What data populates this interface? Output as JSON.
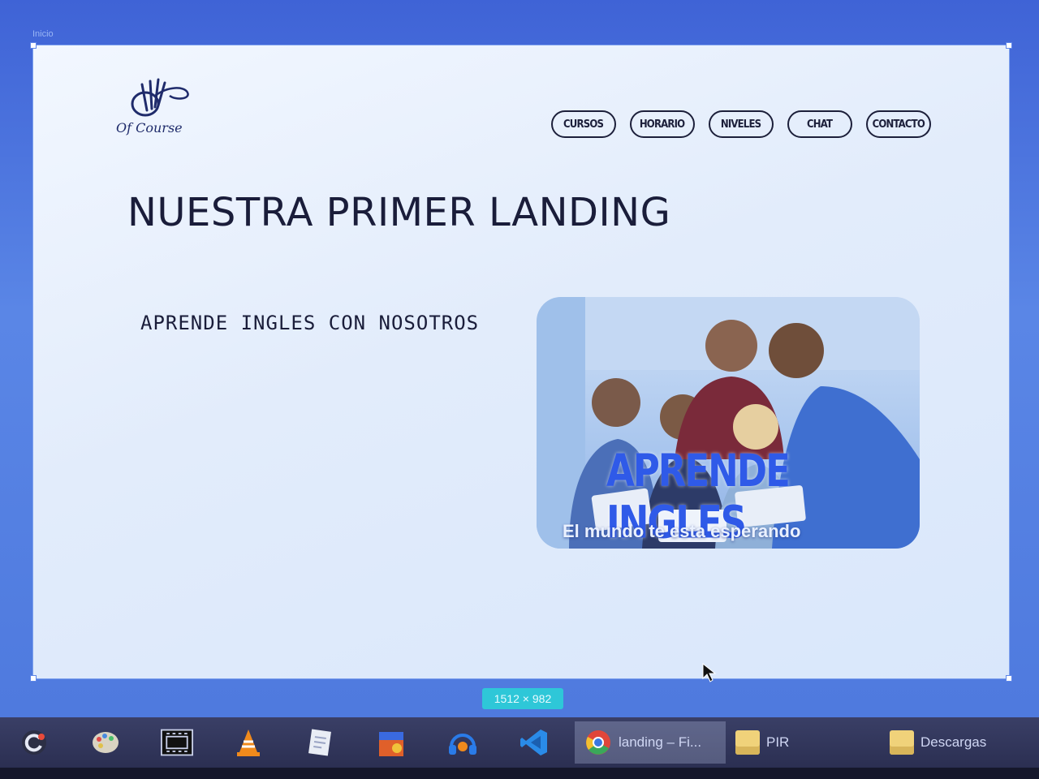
{
  "canvas": {
    "frame_label": "Inicio",
    "size_badge": "1512 × 982"
  },
  "brand": {
    "logo_text": "Of Course"
  },
  "nav": {
    "items": [
      {
        "label": "CURSOS"
      },
      {
        "label": "HORARIO"
      },
      {
        "label": "NIVELES"
      },
      {
        "label": "CHAT"
      },
      {
        "label": "CONTACTO"
      }
    ]
  },
  "main": {
    "title": "NUESTRA PRIMER LANDING",
    "subtitle": "APRENDE INGLES CON NOSOTROS"
  },
  "hero": {
    "heading": "APRENDE INGLES",
    "tagline": "El mundo te esta esperando"
  },
  "taskbar": {
    "apps": [
      {
        "icon": "refresh-app-icon"
      },
      {
        "icon": "paint-palette-icon"
      },
      {
        "icon": "video-editor-icon"
      },
      {
        "icon": "vlc-cone-icon"
      },
      {
        "icon": "notes-icon"
      },
      {
        "icon": "store-bag-icon"
      },
      {
        "icon": "headphones-icon"
      },
      {
        "icon": "vscode-icon"
      }
    ],
    "windows": [
      {
        "title": "landing – Fi...",
        "icon": "chrome-icon"
      },
      {
        "title": "PIR",
        "icon": "folder-icon"
      },
      {
        "title": "Descargas",
        "icon": "folder-icon"
      }
    ]
  },
  "colors": {
    "accent": "#2f5ae8",
    "text": "#1a1d3a",
    "canvas_bg": "#4d78dd"
  }
}
